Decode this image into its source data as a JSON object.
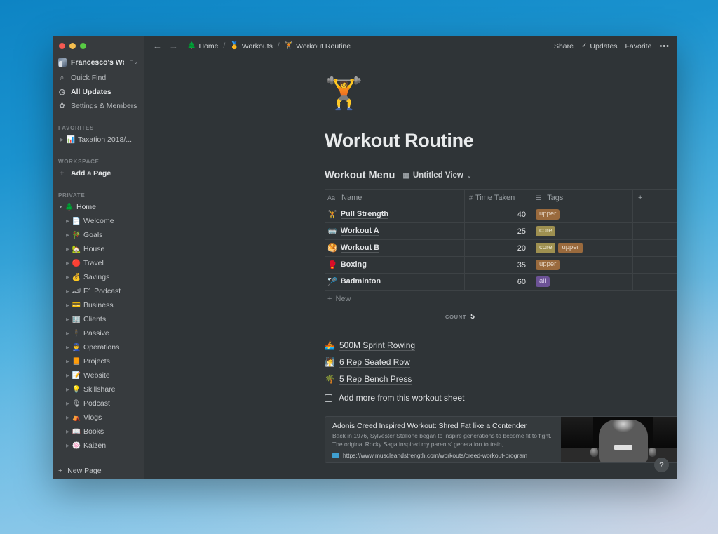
{
  "window": {
    "traffic_lights": [
      "close",
      "minimize",
      "maximize"
    ]
  },
  "sidebar": {
    "workspace": {
      "name": "Francesco's Wo...",
      "chevron": "⌃⌄"
    },
    "quick_nav": [
      {
        "label": "Quick Find",
        "icon": "search-icon",
        "glyph": "⌕"
      },
      {
        "label": "All Updates",
        "icon": "clock-icon",
        "glyph": "◷"
      },
      {
        "label": "Settings & Members",
        "icon": "gear-icon",
        "glyph": "✿"
      }
    ],
    "favorites_label": "FAVORITES",
    "favorites": [
      {
        "label": "Taxation 2018/...",
        "emoji": "📊"
      }
    ],
    "workspace_label": "WORKSPACE",
    "add_page": {
      "label": "Add a Page",
      "glyph": "+"
    },
    "private_label": "PRIVATE",
    "private": [
      {
        "label": "Home",
        "emoji": "🌲",
        "expanded": true,
        "level": 0
      },
      {
        "label": "Welcome",
        "emoji": "📄",
        "expanded": false,
        "level": 1
      },
      {
        "label": "Goals",
        "emoji": "🎋",
        "expanded": false,
        "level": 1
      },
      {
        "label": "House",
        "emoji": "🏡",
        "expanded": false,
        "level": 1
      },
      {
        "label": "Travel",
        "emoji": "🔴",
        "expanded": false,
        "level": 1
      },
      {
        "label": "Savings",
        "emoji": "💰",
        "expanded": false,
        "level": 1
      },
      {
        "label": "F1 Podcast",
        "emoji": "🏎",
        "expanded": false,
        "level": 1
      },
      {
        "label": "Business",
        "emoji": "💳",
        "expanded": false,
        "level": 1
      },
      {
        "label": "Clients",
        "emoji": "🏢",
        "expanded": false,
        "level": 1
      },
      {
        "label": "Passive",
        "emoji": "🕴",
        "expanded": false,
        "level": 1
      },
      {
        "label": "Operations",
        "emoji": "👮",
        "expanded": false,
        "level": 1
      },
      {
        "label": "Projects",
        "emoji": "📙",
        "expanded": false,
        "level": 1
      },
      {
        "label": "Website",
        "emoji": "📝",
        "expanded": false,
        "level": 1
      },
      {
        "label": "Skillshare",
        "emoji": "💡",
        "expanded": false,
        "level": 1
      },
      {
        "label": "Podcast",
        "emoji": "🎙",
        "expanded": false,
        "level": 1
      },
      {
        "label": "Vlogs",
        "emoji": "⛺",
        "expanded": false,
        "level": 1
      },
      {
        "label": "Books",
        "emoji": "📖",
        "expanded": false,
        "level": 1
      },
      {
        "label": "Kaizen",
        "emoji": "🍥",
        "expanded": false,
        "level": 1
      }
    ],
    "new_page": {
      "label": "New Page",
      "glyph": "+"
    }
  },
  "topbar": {
    "back_glyph": "←",
    "forward_glyph": "→",
    "breadcrumbs": [
      {
        "label": "Home",
        "emoji": "🌲"
      },
      {
        "label": "Workouts",
        "emoji": "🥇"
      },
      {
        "label": "Workout Routine",
        "emoji": "🏋"
      }
    ],
    "separator": "/",
    "share_label": "Share",
    "updates_label": "Updates",
    "updates_check": "✓",
    "favorite_label": "Favorite",
    "more_glyph": "•••"
  },
  "page": {
    "emoji": "🏋️",
    "title": "Workout Routine"
  },
  "database": {
    "title": "Workout Menu",
    "view_name": "Untitled View",
    "view_icon": "table-icon",
    "view_chevron": "⌄",
    "columns": [
      {
        "label": "Name",
        "type_icon": "Aa"
      },
      {
        "label": "Time Taken",
        "type_icon": "#"
      },
      {
        "label": "Tags",
        "type_icon": "☰"
      }
    ],
    "add_column_glyph": "+",
    "rows": [
      {
        "emoji": "🏋",
        "name": "Pull Strength",
        "time": "40",
        "tags": [
          "upper"
        ]
      },
      {
        "emoji": "🥽",
        "name": "Workout A",
        "time": "25",
        "tags": [
          "core"
        ]
      },
      {
        "emoji": "🥞",
        "name": "Workout B",
        "time": "20",
        "tags": [
          "core",
          "upper"
        ]
      },
      {
        "emoji": "🥊",
        "name": "Boxing",
        "time": "35",
        "tags": [
          "upper"
        ]
      },
      {
        "emoji": "🏸",
        "name": "Badminton",
        "time": "60",
        "tags": [
          "all"
        ]
      }
    ],
    "new_row_label": "New",
    "new_row_glyph": "+",
    "count_label": "COUNT",
    "count_value": "5",
    "tag_colors": {
      "upper": "#9a6a3d",
      "core": "#9e9050",
      "all": "#6c5296"
    }
  },
  "bullets": [
    {
      "emoji": "🚣",
      "label": "500M Sprint Rowing"
    },
    {
      "emoji": "🧖",
      "label": "6 Rep Seated Row"
    },
    {
      "emoji": "🌴",
      "label": "5 Rep Bench Press"
    }
  ],
  "todo": {
    "label": "Add more from this workout sheet",
    "checked": false
  },
  "bookmark": {
    "title": "Adonis Creed Inspired Workout: Shred Fat like a Contender",
    "description": "Back in 1976, Sylvester Stallone began to inspire generations to become fit to fight. The original Rocky Saga inspired my parents' generation to train,",
    "url": "https://www.muscleandstrength.com/workouts/creed-workout-program"
  },
  "help": {
    "glyph": "?"
  }
}
